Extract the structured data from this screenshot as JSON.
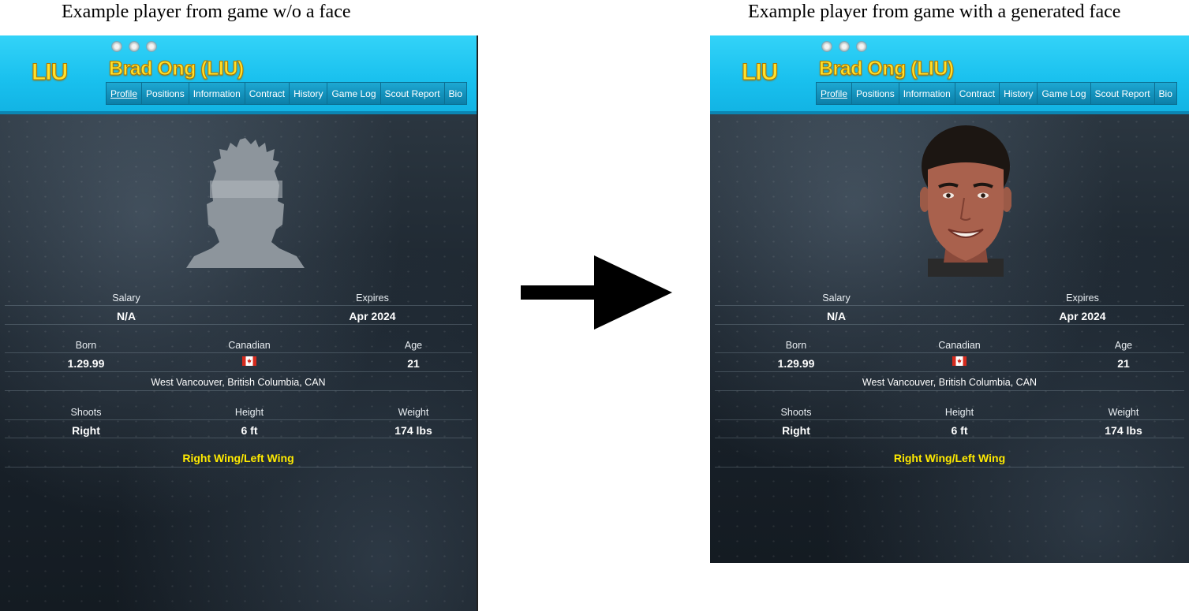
{
  "captions": {
    "left": "Example player from game w/o a face",
    "right": "Example player from game with a generated face"
  },
  "header": {
    "team_abbr": "LIU",
    "player_name": "Brad Ong (LIU)",
    "tabs": [
      "Profile",
      "Positions",
      "Information",
      "Contract",
      "History",
      "Game Log",
      "Scout Report",
      "Bio"
    ],
    "active_tab": "Profile"
  },
  "profile": {
    "salary_label": "Salary",
    "salary_value": "N/A",
    "expires_label": "Expires",
    "expires_value": "Apr 2024",
    "born_label": "Born",
    "born_value": "1.29.99",
    "nationality_label": "Canadian",
    "age_label": "Age",
    "age_value": "21",
    "birthplace": "West Vancouver, British Columbia, CAN",
    "shoots_label": "Shoots",
    "shoots_value": "Right",
    "height_label": "Height",
    "height_value": "6 ft",
    "weight_label": "Weight",
    "weight_value": "174 lbs",
    "position": "Right Wing/Left Wing"
  },
  "colors": {
    "header_blue": "#19c0ee",
    "name_yellow": "#ffe12b",
    "position_yellow": "#ffea00",
    "background_dark": "#1a232c"
  },
  "icons": [
    "silhouette-avatar-icon",
    "player-face-photo",
    "canada-flag-icon",
    "right-arrow-icon"
  ]
}
